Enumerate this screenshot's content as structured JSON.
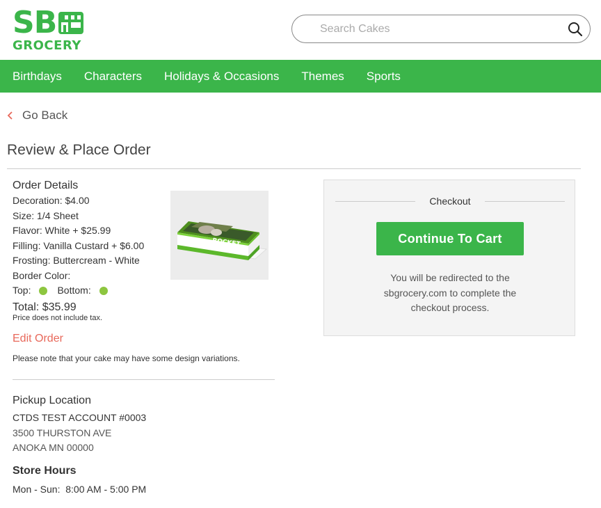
{
  "brand": {
    "logo_top": "SB",
    "logo_bottom": "GROCERY",
    "color": "#3bb54a"
  },
  "search": {
    "placeholder": "Search Cakes",
    "icon": "search-icon"
  },
  "nav": {
    "items": [
      {
        "label": "Birthdays"
      },
      {
        "label": "Characters"
      },
      {
        "label": "Holidays & Occasions"
      },
      {
        "label": "Themes"
      },
      {
        "label": "Sports"
      }
    ]
  },
  "go_back": {
    "label": "Go Back",
    "icon": "chevron-left-icon"
  },
  "page_title": "Review & Place Order",
  "order": {
    "title": "Order Details",
    "lines": [
      "Decoration: $4.00",
      "Size: 1/4 Sheet",
      "Flavor: White + $25.99",
      "Filling: Vanilla Custard + $6.00",
      "Frosting: Buttercream - White",
      "Border Color:"
    ],
    "border_top_label": "Top:",
    "border_bottom_label": "Bottom:",
    "border_color": "#8dc63f",
    "total": "Total: $35.99",
    "tax_note": "Price does not include tax.",
    "edit_label": "Edit Order",
    "variation_note": "Please note that your cake may have some design variations.",
    "cake_text": "ROCKET"
  },
  "pickup": {
    "title": "Pickup Location",
    "store_name": "CTDS TEST ACCOUNT #0003",
    "address_line1": "3500 THURSTON AVE",
    "address_line2": "ANOKA MN 00000",
    "hours_title": "Store Hours",
    "hours": "Mon - Sun:  8:00 AM - 5:00 PM"
  },
  "checkout": {
    "title": "Checkout",
    "button_label": "Continue To Cart",
    "note": "You will be redirected to the sbgrocery.com to complete the checkout process."
  },
  "colors": {
    "accent": "#3bb54a",
    "link_red": "#e8685a"
  }
}
